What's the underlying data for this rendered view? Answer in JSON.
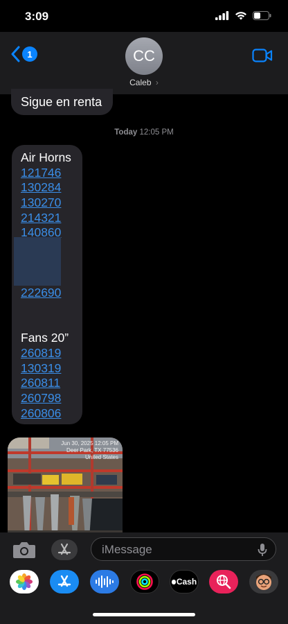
{
  "status_bar": {
    "time": "3:09"
  },
  "header": {
    "unread_count": "1",
    "avatar_initials": "CC",
    "contact_name": "Caleb",
    "contact_chevron": "›"
  },
  "thread": {
    "previous_message": "Sigue en renta",
    "timestamp_day": "Today",
    "timestamp_time": "12:05 PM",
    "message": {
      "heading_1": "Air Horns",
      "air_horn_links": [
        "121746",
        "130284",
        "130270",
        "214321",
        "140860",
        "222690"
      ],
      "heading_2": "Fans 20”",
      "fan_links": [
        "260819",
        "130319",
        "260811",
        "260798",
        "260806"
      ]
    },
    "photo": {
      "overlay_text": [
        "Jun 30, 2025 12:05 PM",
        "Deer Park, TX 77536",
        "United States"
      ]
    }
  },
  "composer": {
    "placeholder": "iMessage"
  },
  "app_drawer": {
    "apps": [
      "photos-app",
      "app-store-app",
      "audio-message-app",
      "fitness-activity-app",
      "apple-cash-app",
      "search-images-app",
      "memoji-app"
    ],
    "cash_label": "Cash"
  },
  "colors": {
    "link": "#3a8ee8",
    "accent": "#0a84ff",
    "bubble": "#26252a",
    "background": "#000000"
  }
}
